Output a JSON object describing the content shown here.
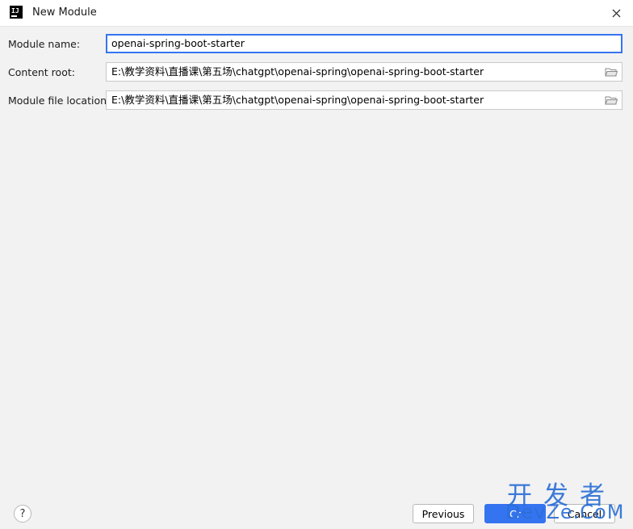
{
  "window": {
    "app_icon": "IJ",
    "title": "New Module",
    "close_icon": "close-icon"
  },
  "form": {
    "module_name": {
      "label": "Module name:",
      "value": "openai-spring-boot-starter"
    },
    "content_root": {
      "label": "Content root:",
      "value": "E:\\教学资料\\直播课\\第五场\\chatgpt\\openai-spring\\openai-spring-boot-starter"
    },
    "module_file_location": {
      "label": "Module file location:",
      "value": "E:\\教学资料\\直播课\\第五场\\chatgpt\\openai-spring\\openai-spring-boot-starter"
    }
  },
  "footer": {
    "help_label": "?",
    "previous_label": "Previous",
    "create_label": "Cr",
    "cancel_label": "Cancel"
  },
  "watermark": {
    "top": "开发者",
    "bottom": "DevZe.CoM"
  },
  "colors": {
    "accent": "#3574f0",
    "background": "#f2f2f2",
    "watermark": "#2b6fd6"
  }
}
